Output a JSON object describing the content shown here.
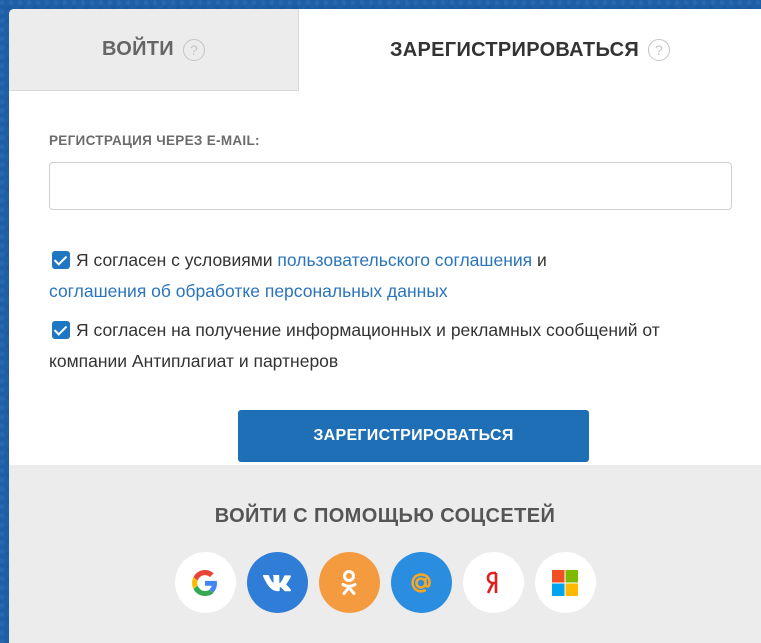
{
  "tabs": {
    "login": "ВОЙТИ",
    "register": "ЗАРЕГИСТРИРОВАТЬСЯ",
    "help_glyph": "?"
  },
  "form": {
    "email_label": "РЕГИСТРАЦИЯ ЧЕРЕЗ E-MAIL:",
    "email_value": "",
    "email_placeholder": "",
    "agree_terms": {
      "checked": true,
      "prefix": "Я согласен с условиями ",
      "link1": "пользовательского соглашения",
      "middle": " и ",
      "link2": "соглашения об обработке персональных данных"
    },
    "agree_marketing": {
      "checked": true,
      "text": "Я согласен на получение информационных и рекламных сообщений от компании Антиплагиат и партнеров"
    },
    "submit_label": "ЗАРЕГИСТРИРОВАТЬСЯ"
  },
  "social": {
    "title": "ВОЙТИ С ПОМОЩЬЮ СОЦСЕТЕЙ",
    "providers": [
      {
        "name": "google-icon",
        "glyph": "G"
      },
      {
        "name": "vk-icon",
        "glyph": "vk"
      },
      {
        "name": "odnoklassniki-icon",
        "glyph": "ok"
      },
      {
        "name": "mailru-icon",
        "glyph": "@"
      },
      {
        "name": "yandex-icon",
        "glyph": "Я"
      },
      {
        "name": "microsoft-icon",
        "glyph": ""
      }
    ]
  },
  "colors": {
    "accent": "#1f6fb6",
    "link": "#2a74bc",
    "background": "#1f5fa8",
    "vk": "#2f7dd6",
    "ok": "#f59b3f",
    "mailru": "#2a8de0",
    "yandex": "#e02020"
  }
}
